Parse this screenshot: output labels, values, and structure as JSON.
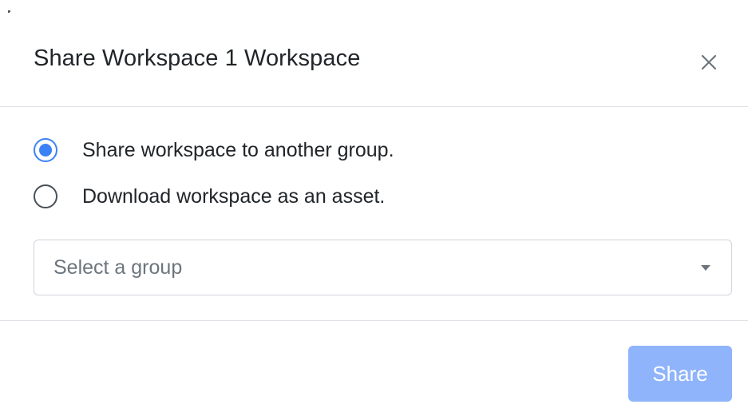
{
  "modal": {
    "title": "Share Workspace 1 Workspace",
    "close_icon": "close-icon"
  },
  "options": [
    {
      "label": "Share workspace to another group.",
      "selected": true
    },
    {
      "label": "Download workspace as an asset.",
      "selected": false
    }
  ],
  "group_select": {
    "placeholder": "Select a group",
    "caret_icon": "caret-down-icon"
  },
  "footer": {
    "share_label": "Share",
    "share_enabled": false
  },
  "colors": {
    "accent": "#3b82f6",
    "button_disabled": "#8fb4fb",
    "border": "#dee2e6"
  }
}
